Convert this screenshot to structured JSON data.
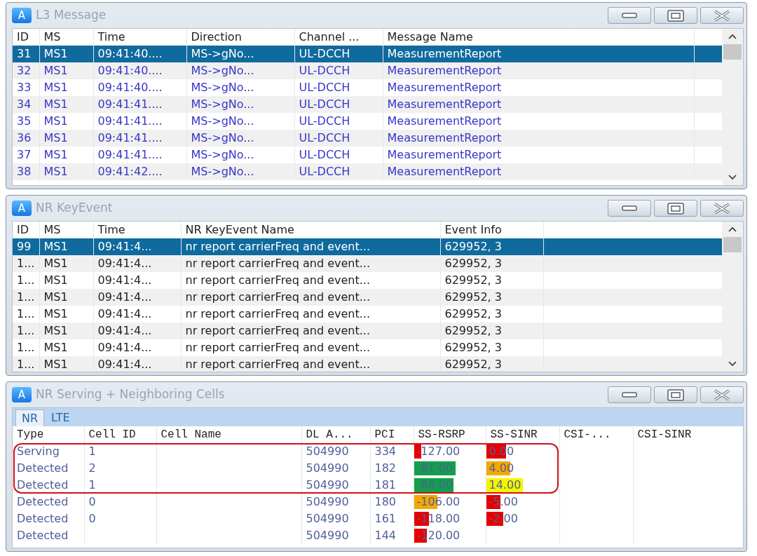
{
  "windows": [
    {
      "kind": "list",
      "title": "L3 Message",
      "icon_letter": "A",
      "columns": [
        "ID",
        "MS",
        "Time",
        "Direction",
        "Channel ...",
        "Message Name"
      ],
      "rows": [
        {
          "selected": true,
          "cells": [
            "31",
            "MS1",
            "09:41:40....",
            "MS->gNo...",
            "UL-DCCH",
            "MeasurementReport"
          ]
        },
        {
          "selected": false,
          "cells": [
            "32",
            "MS1",
            "09:41:40....",
            "MS->gNo...",
            "UL-DCCH",
            "MeasurementReport"
          ]
        },
        {
          "selected": false,
          "cells": [
            "33",
            "MS1",
            "09:41:40....",
            "MS->gNo...",
            "UL-DCCH",
            "MeasurementReport"
          ]
        },
        {
          "selected": false,
          "cells": [
            "34",
            "MS1",
            "09:41:41....",
            "MS->gNo...",
            "UL-DCCH",
            "MeasurementReport"
          ]
        },
        {
          "selected": false,
          "cells": [
            "35",
            "MS1",
            "09:41:41....",
            "MS->gNo...",
            "UL-DCCH",
            "MeasurementReport"
          ]
        },
        {
          "selected": false,
          "cells": [
            "36",
            "MS1",
            "09:41:41....",
            "MS->gNo...",
            "UL-DCCH",
            "MeasurementReport"
          ]
        },
        {
          "selected": false,
          "cells": [
            "37",
            "MS1",
            "09:41:41....",
            "MS->gNo...",
            "UL-DCCH",
            "MeasurementReport"
          ]
        },
        {
          "selected": false,
          "cells": [
            "38",
            "MS1",
            "09:41:42....",
            "MS->gNo...",
            "UL-DCCH",
            "MeasurementReport"
          ]
        }
      ]
    },
    {
      "kind": "list",
      "title": "NR KeyEvent",
      "icon_letter": "A",
      "columns": [
        "ID",
        "MS",
        "Time",
        "NR KeyEvent Name",
        "Event Info"
      ],
      "rows": [
        {
          "selected": true,
          "cells": [
            "99",
            "MS1",
            "09:41:4...",
            "nr report carrierFreq and event...",
            "629952, 3"
          ]
        },
        {
          "selected": false,
          "cells": [
            "1...",
            "MS1",
            "09:41:4...",
            "nr report carrierFreq and event...",
            "629952, 3"
          ]
        },
        {
          "selected": false,
          "cells": [
            "1...",
            "MS1",
            "09:41:4...",
            "nr report carrierFreq and event...",
            "629952, 3"
          ]
        },
        {
          "selected": false,
          "cells": [
            "1...",
            "MS1",
            "09:41:4...",
            "nr report carrierFreq and event...",
            "629952, 3"
          ]
        },
        {
          "selected": false,
          "cells": [
            "1...",
            "MS1",
            "09:41:4...",
            "nr report carrierFreq and event...",
            "629952, 3"
          ]
        },
        {
          "selected": false,
          "cells": [
            "1...",
            "MS1",
            "09:41:4...",
            "nr report carrierFreq and event...",
            "629952, 3"
          ]
        },
        {
          "selected": false,
          "cells": [
            "1...",
            "MS1",
            "09:41:4...",
            "nr report carrierFreq and event...",
            "629952, 3"
          ]
        },
        {
          "selected": false,
          "cells": [
            "1...",
            "MS1",
            "09:41:4...",
            "nr report carrierFreq and event...",
            "629952, 3"
          ]
        }
      ]
    },
    {
      "kind": "cells",
      "title": "NR Serving + Neighboring Cells",
      "icon_letter": "A",
      "tabs": [
        {
          "label": "NR",
          "selected": true
        },
        {
          "label": "LTE",
          "selected": false
        }
      ],
      "columns": [
        "Type",
        "Cell ID",
        "Cell Name",
        "DL A...",
        "PCI",
        "SS-RSRP",
        "SS-SINR",
        "CSI-...",
        "CSI-SINR"
      ],
      "rows": [
        {
          "highlighted": true,
          "type": "Serving",
          "cell_id": "1",
          "dl": "504990",
          "pci": "334",
          "rsrp": {
            "text": "-127.00",
            "level": 0.1,
            "color": "#e80000"
          },
          "sinr": {
            "text": "0.00",
            "level": 0.27,
            "color": "#e80000"
          }
        },
        {
          "highlighted": true,
          "type": "Detected",
          "cell_id": "2",
          "dl": "504990",
          "pci": "182",
          "rsrp": {
            "text": "-81.00",
            "level": 0.58,
            "color": "#12a04a"
          },
          "sinr": {
            "text": "4.00",
            "level": 0.33,
            "color": "#f5a800"
          }
        },
        {
          "highlighted": true,
          "type": "Detected",
          "cell_id": "1",
          "dl": "504990",
          "pci": "181",
          "rsrp": {
            "text": "-84.00",
            "level": 0.55,
            "color": "#12a04a"
          },
          "sinr": {
            "text": "14.00",
            "level": 0.5,
            "color": "#f5f500"
          }
        },
        {
          "highlighted": false,
          "type": "Detected",
          "cell_id": "0",
          "dl": "504990",
          "pci": "180",
          "rsrp": {
            "text": "-106.00",
            "level": 0.33,
            "color": "#f5a800"
          },
          "sinr": {
            "text": "-5.00",
            "level": 0.2,
            "color": "#e80000"
          }
        },
        {
          "highlighted": false,
          "type": "Detected",
          "cell_id": "0",
          "dl": "504990",
          "pci": "161",
          "rsrp": {
            "text": "-118.00",
            "level": 0.21,
            "color": "#e80000"
          },
          "sinr": {
            "text": "-2.00",
            "level": 0.24,
            "color": "#e80000"
          }
        },
        {
          "highlighted": false,
          "type": "Detected",
          "dl": "504990",
          "pci": "144",
          "rsrp": {
            "text": "-120.00",
            "level": 0.18,
            "color": "#e80000"
          }
        }
      ]
    }
  ]
}
